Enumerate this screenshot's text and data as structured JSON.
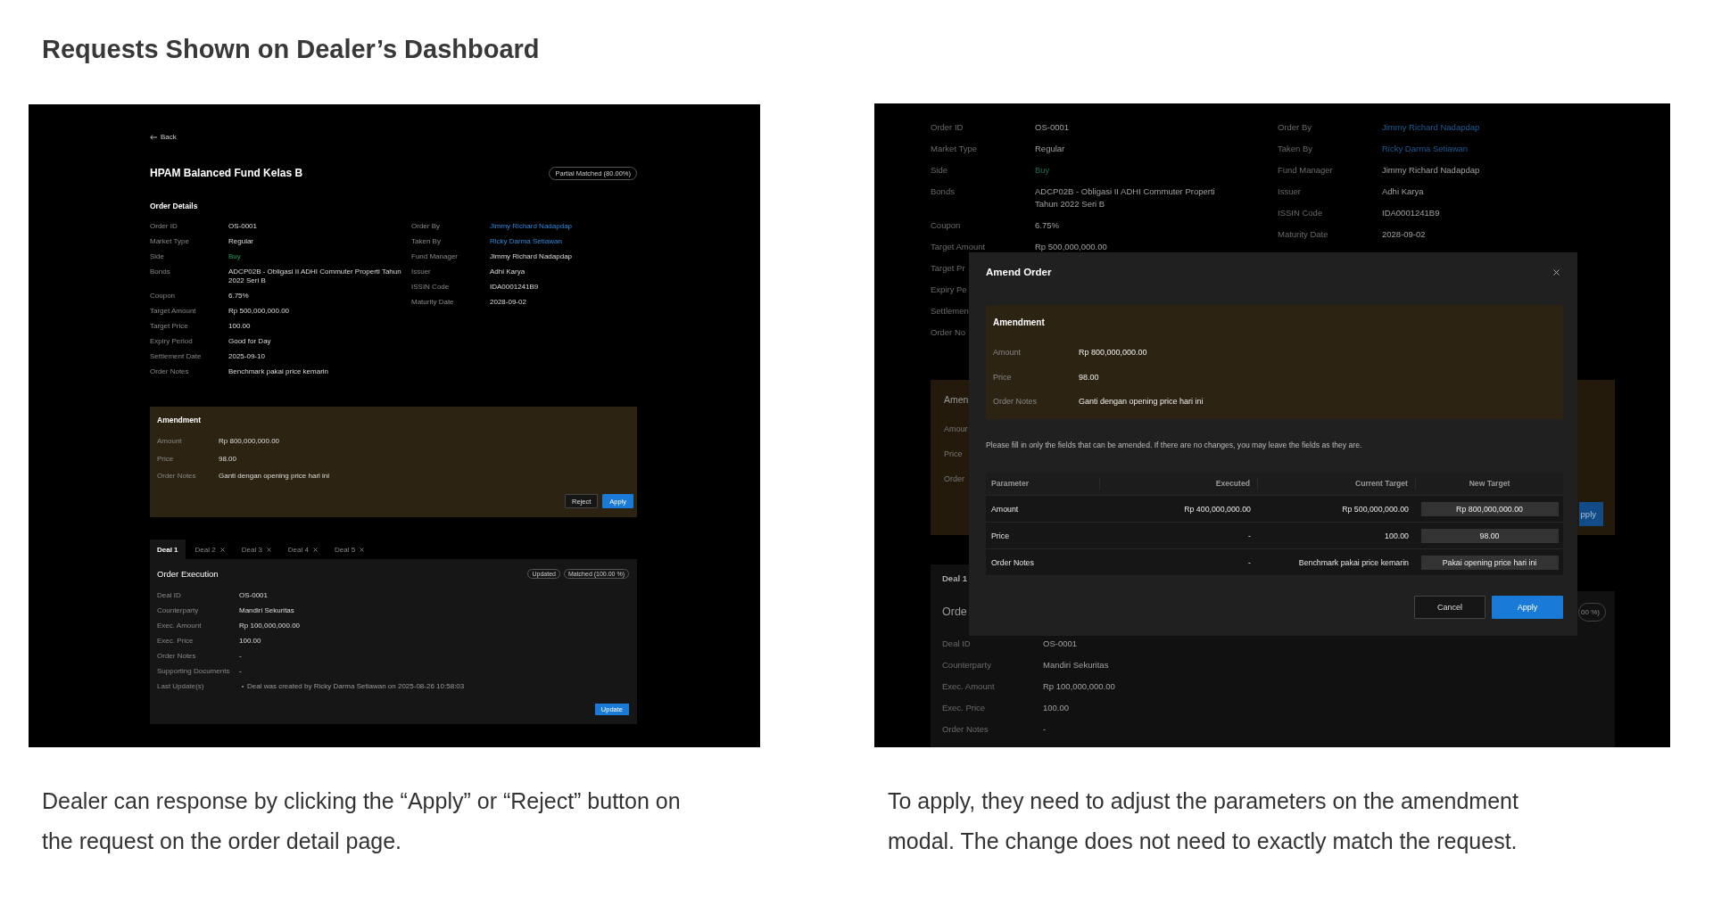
{
  "heading": "Requests Shown on Dealer’s Dashboard",
  "left_screenshot": {
    "back": "Back",
    "title": "HPAM Balanced Fund Kelas B",
    "status_pill": "Partial Matched (80.00%)",
    "section_title": "Order Details",
    "details_left": [
      {
        "label": "Order ID",
        "value": "OS-0001",
        "kind": "text"
      },
      {
        "label": "Market Type",
        "value": "Regular",
        "kind": "text"
      },
      {
        "label": "Side",
        "value": "Buy",
        "kind": "positive"
      },
      {
        "label": "Bonds",
        "value": "ADCP02B - Obligasi II ADHI Commuter Properti Tahun 2022 Seri B",
        "kind": "text"
      },
      {
        "label": "Coupon",
        "value": "6.75%",
        "kind": "text"
      },
      {
        "label": "Target Amount",
        "value": "Rp 500,000,000.00",
        "kind": "text"
      },
      {
        "label": "Target Price",
        "value": "100.00",
        "kind": "text"
      },
      {
        "label": "Expiry Period",
        "value": "Good for Day",
        "kind": "text"
      },
      {
        "label": "Settlement Date",
        "value": "2025-09-10",
        "kind": "text"
      },
      {
        "label": "Order Notes",
        "value": "Benchmark pakai price kemarin",
        "kind": "text"
      }
    ],
    "details_right": [
      {
        "label": "Order By",
        "value": "Jimmy Richard Nadapdap",
        "kind": "link"
      },
      {
        "label": "Taken By",
        "value": "Ricky Darma Setiawan",
        "kind": "link"
      },
      {
        "label": "Fund Manager",
        "value": "Jimmy Richard Nadapdap",
        "kind": "text"
      },
      {
        "label": "Issuer",
        "value": "Adhi Karya",
        "kind": "text"
      },
      {
        "label": "ISSIN Code",
        "value": "IDA0001241B9",
        "kind": "text"
      },
      {
        "label": "Maturity Date",
        "value": "2028-09-02",
        "kind": "text"
      }
    ],
    "amendment": {
      "title": "Amendment",
      "rows": [
        {
          "label": "Amount",
          "value": "Rp 800,000,000.00"
        },
        {
          "label": "Price",
          "value": "98.00"
        },
        {
          "label": "Order Notes",
          "value": "Ganti dengan opening price hari ini"
        }
      ],
      "buttons": [
        {
          "label": "Reject",
          "kind": "secondary"
        },
        {
          "label": "Apply",
          "kind": "primary"
        }
      ]
    },
    "deal_tabs": [
      {
        "label": "Deal 1",
        "selected": true,
        "closable": false
      },
      {
        "label": "Deal 2",
        "selected": false,
        "closable": true
      },
      {
        "label": "Deal 3",
        "selected": false,
        "closable": true
      },
      {
        "label": "Deal 4",
        "selected": false,
        "closable": true
      },
      {
        "label": "Deal 5",
        "selected": false,
        "closable": true
      }
    ],
    "execution": {
      "title": "Order Execution",
      "badges": [
        "Updated",
        "Matched (100.00 %)"
      ],
      "rows": [
        {
          "label": "Deal ID",
          "value": "OS-0001",
          "kind": "text"
        },
        {
          "label": "Counterparty",
          "value": "Mandiri Sekuritas",
          "kind": "text"
        },
        {
          "label": "Exec. Amount",
          "value": "Rp 100,000,000.00",
          "kind": "text"
        },
        {
          "label": "Exec. Price",
          "value": "100.00",
          "kind": "text"
        },
        {
          "label": "Order Notes",
          "value": "-",
          "kind": "text"
        },
        {
          "label": "Supporting Documents",
          "value": "-",
          "kind": "text"
        },
        {
          "label": "Last Update(s)",
          "value": "Deal was created by Ricky Darma Setiawan on 2025-08-26 10:58:03",
          "kind": "bullet"
        }
      ],
      "button": "Update"
    }
  },
  "right_screenshot": {
    "background": {
      "details_left": [
        {
          "label": "Order ID",
          "value": "OS-0001",
          "kind": "text"
        },
        {
          "label": "Market Type",
          "value": "Regular",
          "kind": "text"
        },
        {
          "label": "Side",
          "value": "Buy",
          "kind": "positive"
        },
        {
          "label": "Bonds",
          "value": "ADCP02B - Obligasi II ADHI Commuter Properti Tahun 2022 Seri B",
          "kind": "text"
        },
        {
          "label": "Coupon",
          "value": "6.75%",
          "kind": "text"
        },
        {
          "label": "Target Amount",
          "value": "Rp 500,000,000.00",
          "kind": "text"
        },
        {
          "label": "Target Pr"
        },
        {
          "label": "Expiry Pe"
        },
        {
          "label": "Settlemen"
        },
        {
          "label": "Order No"
        }
      ],
      "details_right": [
        {
          "label": "Order By",
          "value": "Jimmy Richard Nadapdap",
          "kind": "link"
        },
        {
          "label": "Taken By",
          "value": "Ricky Darma Setiawan",
          "kind": "link"
        },
        {
          "label": "Fund Manager",
          "value": "Jimmy Richard Nadapdap",
          "kind": "text"
        },
        {
          "label": "Issuer",
          "value": "Adhi Karya",
          "kind": "text"
        },
        {
          "label": "ISSIN Code",
          "value": "IDA0001241B9",
          "kind": "text"
        },
        {
          "label": "Maturity Date",
          "value": "2028-09-02",
          "kind": "text"
        }
      ],
      "amendment": {
        "title": "Amen",
        "labels": [
          "Amour",
          "Price",
          "Order"
        ],
        "button": "pply"
      },
      "deal_tab": "Deal 1",
      "card_title": "Orde",
      "badge": "00 %)",
      "deal_rows": [
        {
          "label": "Deal ID",
          "value": "OS-0001"
        },
        {
          "label": "Counterparty",
          "value": "Mandiri Sekuritas"
        },
        {
          "label": "Exec. Amount",
          "value": "Rp 100,000,000.00"
        },
        {
          "label": "Exec. Price",
          "value": "100.00"
        },
        {
          "label": "Order Notes",
          "value": "-"
        }
      ]
    },
    "modal": {
      "title": "Amend Order",
      "amendment": {
        "title": "Amendment",
        "rows": [
          {
            "label": "Amount",
            "value": "Rp 800,000,000.00"
          },
          {
            "label": "Price",
            "value": "98.00"
          },
          {
            "label": "Order Notes",
            "value": "Ganti dengan opening price hari ini"
          }
        ]
      },
      "note": "Please fill in only the fields that can be amended. If there are no changes, you may leave the fields as they are.",
      "table": {
        "columns": [
          "Parameter",
          "Executed",
          "Current Target",
          "New Target"
        ],
        "rows": [
          {
            "parameter": "Amount",
            "executed": "Rp 400,000,000.00",
            "current_target": "Rp 500,000,000.00",
            "new_target": "Rp 800,000,000.00"
          },
          {
            "parameter": "Price",
            "executed": "-",
            "current_target": "100.00",
            "new_target": "98.00"
          },
          {
            "parameter": "Order Notes",
            "executed": "-",
            "current_target": "Benchmark pakai price kemarin",
            "new_target": "Pakai opening price hari ini"
          }
        ]
      },
      "buttons": [
        {
          "label": "Cancel",
          "kind": "secondary"
        },
        {
          "label": "Apply",
          "kind": "primary"
        }
      ]
    }
  },
  "captions": [
    "Dealer can response by clicking the “Apply” or “Reject” button on the request on the order detail page.",
    "To apply, they need to adjust the parameters on the amendment modal. The change does not need to exactly match the request."
  ]
}
